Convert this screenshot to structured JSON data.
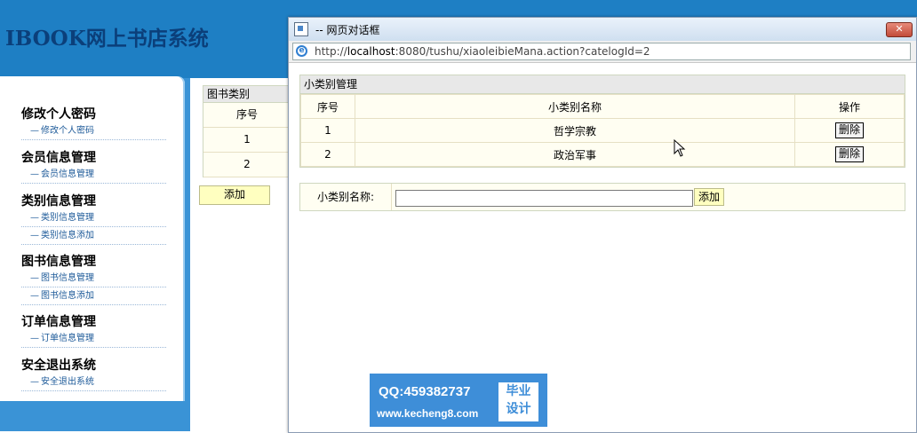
{
  "header": {
    "logo_prefix": "IBOOK",
    "logo_rest": "网上书店系统"
  },
  "menu": {
    "groups": [
      {
        "title": "修改个人密码",
        "items": [
          "修改个人密码"
        ]
      },
      {
        "title": "会员信息管理",
        "items": [
          "会员信息管理"
        ]
      },
      {
        "title": "类别信息管理",
        "items": [
          "类别信息管理",
          "类别信息添加"
        ]
      },
      {
        "title": "图书信息管理",
        "items": [
          "图书信息管理",
          "图书信息添加"
        ]
      },
      {
        "title": "订单信息管理",
        "items": [
          "订单信息管理"
        ]
      },
      {
        "title": "安全退出系统",
        "items": [
          "安全退出系统"
        ]
      }
    ],
    "dash": "—"
  },
  "category_panel": {
    "title": "图书类别",
    "header_col": "序号",
    "rows": [
      "1",
      "2"
    ],
    "add_label": "添加"
  },
  "dialog": {
    "title": "-- 网页对话框",
    "close_label": "✕",
    "url_prefix": "http://",
    "url_host": "localhost",
    "url_rest": ":8080/tushu/xiaoleibieMana.action?catelogId=2",
    "panel_title": "小类别管理",
    "columns": [
      "序号",
      "小类别名称",
      "操作"
    ],
    "rows": [
      {
        "no": "1",
        "name": "哲学宗教",
        "action": "删除"
      },
      {
        "no": "2",
        "name": "政治军事",
        "action": "删除"
      }
    ],
    "add_label": "小类别名称:",
    "add_value": "",
    "add_button": "添加"
  },
  "watermark": {
    "qq": "QQ:459382737",
    "url": "www.kecheng8.com",
    "box_line1": "毕业",
    "box_line2": "设计"
  }
}
